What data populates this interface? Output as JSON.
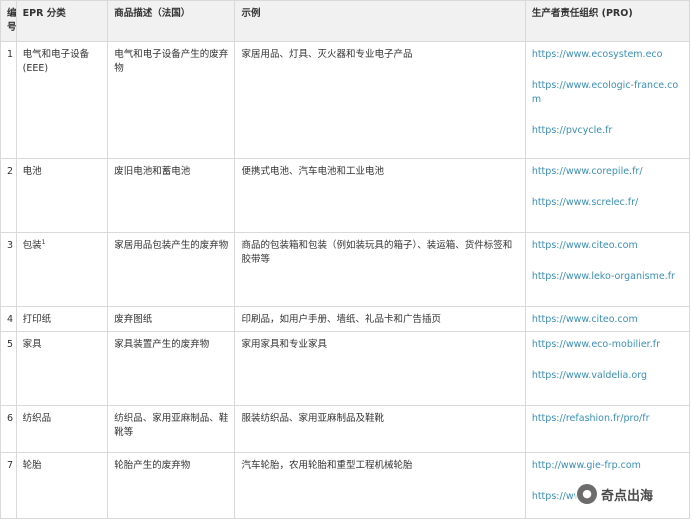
{
  "headers": [
    "编号",
    "EPR 分类",
    "商品描述（法国）",
    "示例",
    "生产者责任组织 (PRO)"
  ],
  "rows": [
    {
      "num": "1",
      "category": "电气和电子设备(EEE)",
      "footnote": "",
      "desc": "电气和电子设备产生的废弃物",
      "examples": "家居用品、灯具、灭火器和专业电子产品",
      "pros": [
        "https://www.ecosystem.eco",
        "https://www.ecologic-france.com",
        "https://pvcycle.fr"
      ]
    },
    {
      "num": "2",
      "category": "电池",
      "footnote": "",
      "desc": "废旧电池和蓄电池",
      "examples": "便携式电池、汽车电池和工业电池",
      "pros": [
        "https://www.corepile.fr/",
        "https://www.screlec.fr/"
      ]
    },
    {
      "num": "3",
      "category": "包装",
      "footnote": "1",
      "desc": "家居用品包装产生的废弃物",
      "examples": "商品的包装箱和包装（例如装玩具的箱子）、装运箱、货件标签和胶带等",
      "pros": [
        "https://www.citeo.com",
        "https://www.leko-organisme.fr"
      ]
    },
    {
      "num": "4",
      "category": "打印纸",
      "footnote": "",
      "desc": "废弃图纸",
      "examples": "印刷品，如用户手册、墙纸、礼品卡和广告插页",
      "pros": [
        "https://www.citeo.com"
      ]
    },
    {
      "num": "5",
      "category": "家具",
      "footnote": "",
      "desc": "家具装置产生的废弃物",
      "examples": "家用家具和专业家具",
      "pros": [
        "https://www.eco-mobilier.fr",
        "https://www.valdelia.org"
      ]
    },
    {
      "num": "6",
      "category": "纺织品",
      "footnote": "",
      "desc": "纺织品、家用亚麻制品、鞋靴等",
      "examples": "服装纺织品、家用亚麻制品及鞋靴",
      "pros": [
        "https://refashion.fr/pro/fr"
      ]
    },
    {
      "num": "7",
      "category": "轮胎",
      "footnote": "",
      "desc": "轮胎产生的废弃物",
      "examples": "汽车轮胎，农用轮胎和重型工程机械轮胎",
      "pros": [
        "http://www.gie-frp.com",
        "https://www."
      ]
    }
  ],
  "watermark": {
    "icon": "wechat-icon",
    "text": "奇点出海"
  }
}
